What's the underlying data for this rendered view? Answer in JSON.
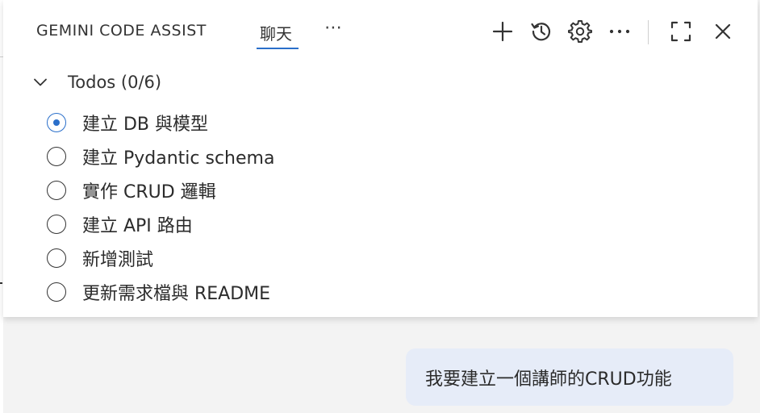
{
  "header": {
    "title": "GEMINI CODE ASSIST",
    "tab_label": "聊天",
    "more_label": "⋯",
    "icons": {
      "new_chat": "plus-icon",
      "history": "history-icon",
      "settings": "gear-icon",
      "more": "more-icon",
      "maximize": "maximize-icon",
      "close": "close-icon"
    }
  },
  "todos": {
    "header": "Todos (0/6)",
    "items": [
      {
        "label": "建立 DB 與模型",
        "status": "in-progress"
      },
      {
        "label": "建立 Pydantic schema",
        "status": "pending"
      },
      {
        "label": "實作 CRUD 邏輯",
        "status": "pending"
      },
      {
        "label": "建立 API 路由",
        "status": "pending"
      },
      {
        "label": "新增測試",
        "status": "pending"
      },
      {
        "label": "更新需求檔與 README",
        "status": "pending"
      }
    ]
  },
  "chat": {
    "user_message": "我要建立一個講師的CRUD功能"
  },
  "colors": {
    "accent": "#2a6fca",
    "bubble_bg": "#e6ecf8",
    "panel_bg": "#ffffff",
    "page_bg": "#f3f3f3"
  }
}
